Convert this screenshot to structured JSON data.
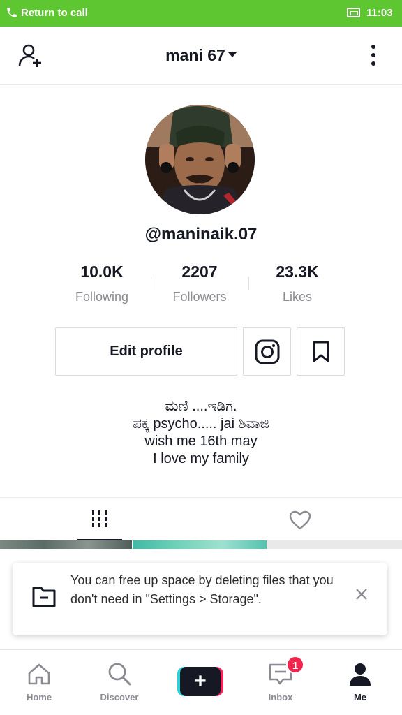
{
  "status_bar": {
    "call_text": "Return to call",
    "time": "11:03",
    "accent_color": "#5ec630"
  },
  "header": {
    "username": "mani 67",
    "icons": [
      "add-user-icon",
      "caret-down-icon",
      "more-vertical-icon"
    ]
  },
  "profile": {
    "handle": "@maninaik.07",
    "stats": [
      {
        "value": "10.0K",
        "label": "Following"
      },
      {
        "value": "2207",
        "label": "Followers"
      },
      {
        "value": "23.3K",
        "label": "Likes"
      }
    ],
    "edit_label": "Edit profile",
    "bio": [
      "ಮಣಿ ....ಇಡಿಗ.",
      "ಪಕ್ಕ psycho..... jai ಶಿವಾಜಿ",
      "wish me 16th may",
      "I love my family"
    ]
  },
  "tabs": {
    "icons": [
      "videos-grid-icon",
      "heart-icon"
    ],
    "active": "videos"
  },
  "toast": {
    "message": "You can free up space by deleting files that you don't need in \"Settings > Storage\"."
  },
  "bottom_nav": {
    "items": [
      {
        "label": "Home",
        "icon": "home-icon"
      },
      {
        "label": "Discover",
        "icon": "search-icon"
      },
      {
        "label": "",
        "icon": "create-icon"
      },
      {
        "label": "Inbox",
        "icon": "inbox-icon"
      },
      {
        "label": "Me",
        "icon": "profile-icon"
      }
    ],
    "inbox_badge": "1",
    "active": "Me"
  }
}
